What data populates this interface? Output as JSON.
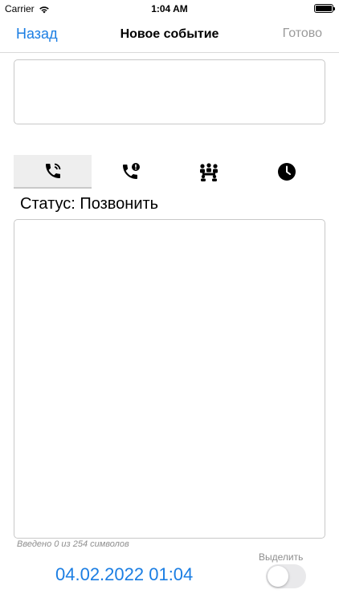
{
  "status_bar": {
    "carrier": "Carrier",
    "time": "1:04 AM",
    "battery_level": 1.0
  },
  "nav": {
    "back": "Назад",
    "title": "Новое событие",
    "done": "Готово"
  },
  "title_field": {
    "value": ""
  },
  "segments": [
    {
      "icon": "phone-call-icon",
      "active": true
    },
    {
      "icon": "phone-alert-icon",
      "active": false
    },
    {
      "icon": "meeting-icon",
      "active": false
    },
    {
      "icon": "clock-icon",
      "active": false
    }
  ],
  "status_text": "Статус: Позвонить",
  "description_field": {
    "value": ""
  },
  "char_counter": "Введено 0 из 254 символов",
  "date_value": "04.02.2022 01:04",
  "highlight": {
    "label": "Выделить",
    "on": false
  },
  "colors": {
    "accent": "#1b7ee3",
    "disabled": "#9a9a9a",
    "border": "#c8c8c8"
  }
}
